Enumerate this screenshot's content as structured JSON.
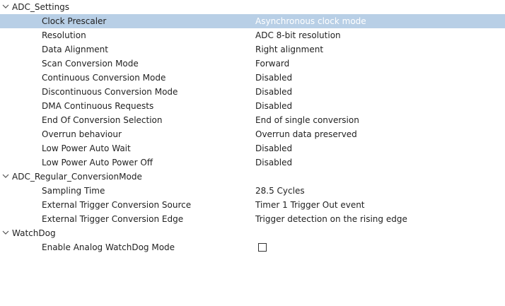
{
  "groups": [
    {
      "label": "ADC_Settings",
      "expanded": true,
      "params": [
        {
          "label": "Clock Prescaler",
          "value": "Asynchronous clock mode",
          "selected": true
        },
        {
          "label": "Resolution",
          "value": "ADC 8-bit resolution"
        },
        {
          "label": "Data Alignment",
          "value": "Right alignment"
        },
        {
          "label": "Scan Conversion Mode",
          "value": "Forward"
        },
        {
          "label": "Continuous Conversion Mode",
          "value": "Disabled"
        },
        {
          "label": "Discontinuous Conversion Mode",
          "value": "Disabled"
        },
        {
          "label": "DMA Continuous Requests",
          "value": "Disabled"
        },
        {
          "label": "End Of Conversion Selection",
          "value": "End of single conversion"
        },
        {
          "label": "Overrun behaviour",
          "value": "Overrun data preserved"
        },
        {
          "label": "Low Power Auto Wait",
          "value": "Disabled"
        },
        {
          "label": "Low Power Auto Power Off",
          "value": "Disabled"
        }
      ]
    },
    {
      "label": "ADC_Regular_ConversionMode",
      "expanded": true,
      "params": [
        {
          "label": "Sampling Time",
          "value": "28.5 Cycles"
        },
        {
          "label": "External Trigger Conversion Source",
          "value": "Timer 1 Trigger Out event"
        },
        {
          "label": "External Trigger Conversion Edge",
          "value": "Trigger detection on the rising edge"
        }
      ]
    },
    {
      "label": "WatchDog",
      "expanded": true,
      "params": [
        {
          "label": "Enable Analog WatchDog Mode",
          "checkbox": true,
          "checked": false
        }
      ]
    }
  ],
  "colors": {
    "selection": "#b8cfe6",
    "text": "#222222"
  },
  "icons": {
    "expand": "chevron-down-icon",
    "checkbox": "checkbox-icon"
  }
}
